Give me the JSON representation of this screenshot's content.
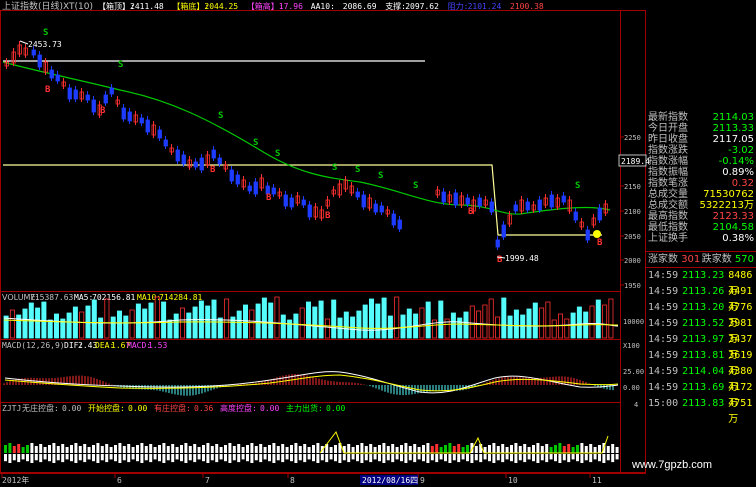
{
  "header": {
    "title": "上证指数(日线)XT(10)",
    "items": [
      {
        "label": "【箱顶】:",
        "value": "2411.48",
        "color": "#ffffff"
      },
      {
        "label": "【箱底】:",
        "value": "2044.25",
        "color": "#ffff00"
      },
      {
        "label": "【箱高】:",
        "value": "17.96",
        "color": "#ff44ff"
      },
      {
        "label": "AA10:",
        "value": "2086.69",
        "color": "#ffffff"
      },
      {
        "label": "支撑:",
        "value": "2097.62",
        "color": "#ffffff"
      },
      {
        "label": "阻力:",
        "value": "2101.24",
        "color": "#4444ff"
      },
      {
        "label": "",
        "value": "2100.38",
        "color": "#ff4444"
      }
    ]
  },
  "price_axis": {
    "ticks": [
      "2250",
      "2200",
      "2150",
      "2100",
      "2050",
      "2000",
      "1950"
    ],
    "current": "2189.4"
  },
  "annotations": {
    "high_label": "2453.73",
    "low_label": "1999.48",
    "signal_s": "S",
    "signal_b": "B"
  },
  "volume": {
    "title": "VOLUME:",
    "vol": "715387.63",
    "ma5_label": "MA5:",
    "ma5": "702156.81",
    "ma10_label": "MA10:",
    "ma10": "714284.81",
    "axis": "10000",
    "unit": "X100"
  },
  "macd": {
    "title": "MACD(12,26,9)",
    "dif_label": "DIF:",
    "dif": "2.43",
    "dea_label": "DEA:",
    "dea": "1.67",
    "macd_label": "MACD:",
    "macd": "1.53",
    "axis_top": "25.00",
    "axis_mid": "0.00"
  },
  "zjtj": {
    "title": "ZJTJ",
    "items": [
      {
        "label": "无庄控盘:",
        "value": "0.00",
        "color": "#c0c0c0"
      },
      {
        "label": "开始控盘:",
        "value": "0.00",
        "color": "#ffff00"
      },
      {
        "label": "有庄控盘:",
        "value": "0.36",
        "color": "#ff4444"
      },
      {
        "label": "高度控盘:",
        "value": "0.00",
        "color": "#ff44ff"
      },
      {
        "label": "主力出货:",
        "value": "0.00",
        "color": "#00ff00"
      }
    ],
    "axis": "4"
  },
  "dates": {
    "labels": [
      "2012年",
      "6",
      "7",
      "8",
      "9",
      "10",
      "11"
    ],
    "cursor": "2012/08/16四"
  },
  "info_panel": {
    "rows": [
      {
        "label": "最新指数",
        "value": "2114.03",
        "color": "#00ff00"
      },
      {
        "label": "今日开盘",
        "value": "2113.33",
        "color": "#00ff00"
      },
      {
        "label": "昨日收盘",
        "value": "2117.05",
        "color": "#ffffff"
      },
      {
        "label": "指数涨跌",
        "value": "-3.02",
        "color": "#00ff00"
      },
      {
        "label": "指数涨幅",
        "value": "-0.14%",
        "color": "#00ff00"
      },
      {
        "label": "指数振幅",
        "value": "0.89%",
        "color": "#ffffff"
      },
      {
        "label": "指数笔涨",
        "value": "0.32",
        "color": "#ff4444"
      },
      {
        "label": "总成交量",
        "value": "71530762",
        "color": "#ffff00"
      },
      {
        "label": "总成交额",
        "value": "5322213万",
        "color": "#ffff00"
      },
      {
        "label": "最高指数",
        "value": "2123.33",
        "color": "#ff4444"
      },
      {
        "label": "最低指数",
        "value": "2104.58",
        "color": "#00ff00"
      },
      {
        "label": "上证换手",
        "value": "0.38%",
        "color": "#ffffff"
      }
    ],
    "up_label": "涨家数",
    "up": "301",
    "down_label": "跌家数",
    "down": "570"
  },
  "ticks": [
    {
      "t": "14:59",
      "p": "2113.23",
      "v": "8486万"
    },
    {
      "t": "14:59",
      "p": "2113.26",
      "v": "4491万"
    },
    {
      "t": "14:59",
      "p": "2113.20",
      "v": "4776万"
    },
    {
      "t": "14:59",
      "p": "2113.52",
      "v": "3981万"
    },
    {
      "t": "14:59",
      "p": "2113.97",
      "v": "3437万"
    },
    {
      "t": "14:59",
      "p": "2113.81",
      "v": "3619万"
    },
    {
      "t": "14:59",
      "p": "2114.04",
      "v": "4380万"
    },
    {
      "t": "14:59",
      "p": "2113.69",
      "v": "4172万"
    },
    {
      "t": "15:00",
      "p": "2113.83",
      "v": "4751万"
    }
  ],
  "watermark": "www.7gpzb.com",
  "colors": {
    "up": "#ff3030",
    "down": "#1e3cff",
    "ma": "#00c800",
    "frame": "#a00000",
    "text": "#c0c0c0",
    "yellow": "#ffff00",
    "cyan": "#54fcfc"
  }
}
